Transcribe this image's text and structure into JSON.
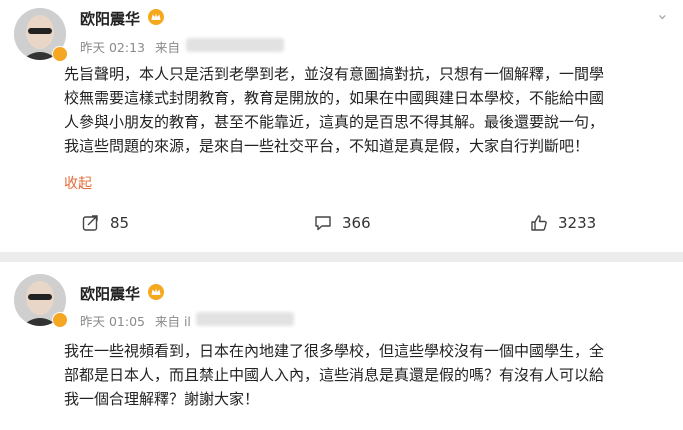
{
  "posts": [
    {
      "author": "欧阳震华",
      "time": "昨天 02:13",
      "source": "来自",
      "body_lines": [
        "先旨聲明，本人只是活到老學到老，並沒有意圖搞對抗，只想有一個解釋，一間學",
        "校無需要這樣式封閉教育，教育是開放的，如果在中國興建日本學校，不能給中國",
        "人參與小朋友的教育，甚至不能靠近，這真的是百思不得其解。最後還要說一句，",
        "我這些問題的來源，是來自一些社交平台，不知道是真是假，大家自行判斷吧！"
      ],
      "collapse_label": "收起",
      "reposts": "85",
      "comments": "366",
      "likes": "3233"
    },
    {
      "author": "欧阳震华",
      "time": "昨天 01:05",
      "source": "来自 il",
      "body_lines": [
        "我在一些視頻看到，日本在內地建了很多學校，但這些學校沒有一個中國學生，全",
        "部都是日本人，而且禁止中國人入內，這些消息是真還是假的嗎？有沒有人可以給",
        "我一個合理解釋？謝謝大家！"
      ]
    }
  ],
  "colors": {
    "accent_orange": "#e36c3a",
    "verify_badge": "#f5a623",
    "meta_gray": "#8a8a8a"
  }
}
